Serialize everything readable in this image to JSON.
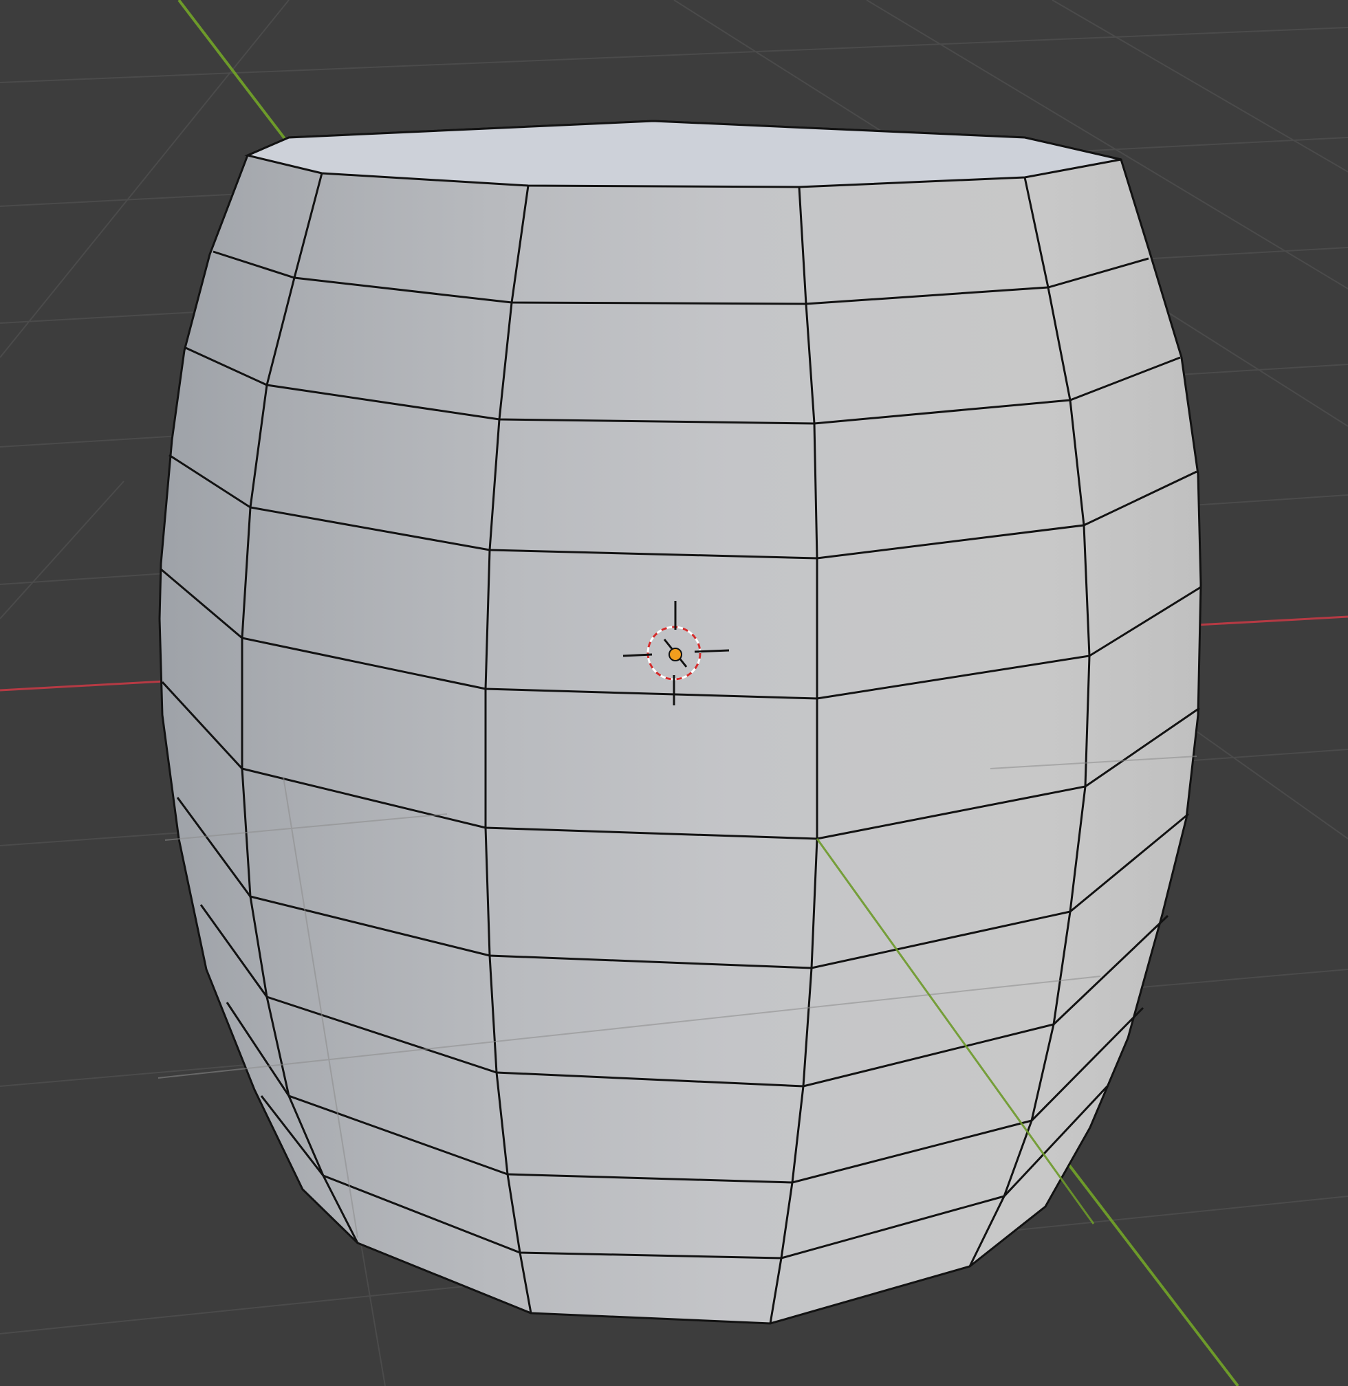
{
  "viewport": {
    "background_color": "#3d3d3d",
    "grid_color": "#4a4a4a",
    "x_axis_color": "#b63a44",
    "y_axis_color": "#6d9a2a"
  },
  "object": {
    "type": "mesh",
    "shape": "barrel",
    "face_color": "#c2c4c8",
    "top_cap_color": "#ccd0d8",
    "edge_color": "#121212",
    "selected": false
  },
  "origin": {
    "icon": "origin-point-icon",
    "color": "#f29d1e"
  },
  "cursor_3d": {
    "icon": "3d-cursor-icon",
    "ring_colors": [
      "#d42a2a",
      "#ffffff"
    ]
  }
}
